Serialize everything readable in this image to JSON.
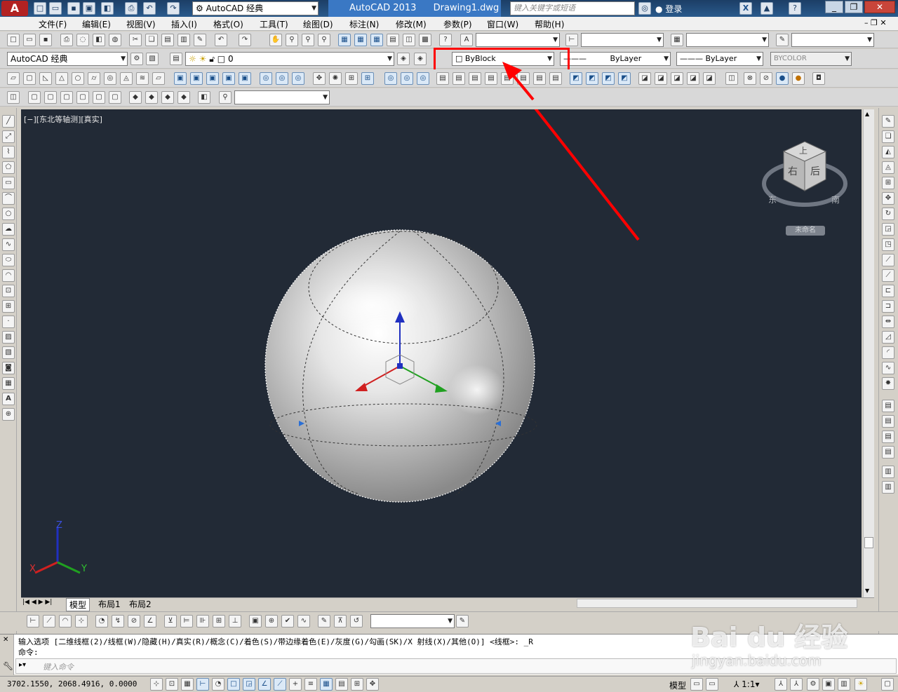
{
  "titlebar": {
    "workspace_combo": "AutoCAD 经典",
    "app_title": "AutoCAD 2013",
    "doc_title": "Drawing1.dwg",
    "search_placeholder": "键入关键字或短语",
    "login_label": "登录",
    "help_label": "?"
  },
  "menu": [
    "文件(F)",
    "编辑(E)",
    "视图(V)",
    "插入(I)",
    "格式(O)",
    "工具(T)",
    "绘图(D)",
    "标注(N)",
    "修改(M)",
    "参数(P)",
    "窗口(W)",
    "帮助(H)"
  ],
  "properties": {
    "workspace": "AutoCAD 经典",
    "layer": "0",
    "color": "ByBlock",
    "linetype": "ByLayer",
    "lineweight": "ByLayer",
    "plotstyle": "BYCOLOR"
  },
  "viewport": {
    "label": "[−][东北等轴测][真实]",
    "viewcube_top": "上",
    "viewcube_right": "右",
    "viewcube_front": "后",
    "compass_e": "东",
    "compass_s": "南",
    "named_view": "未命名",
    "ucs_z": "Z",
    "ucs_x": "X",
    "ucs_y": "Y"
  },
  "tabs": [
    "模型",
    "布局1",
    "布局2"
  ],
  "command": {
    "history": "输入选项 [二维线框(2)/线框(W)/隐藏(H)/真实(R)/概念(C)/着色(S)/带边缘着色(E)/灰度(G)/勾画(SK)/X 射线(X)/其他(O)] <线框>: _R",
    "prompt": "命令:",
    "input_placeholder": "键入命令"
  },
  "status": {
    "coordinates": "3702.1550, 2068.4916, 0.0000",
    "model_label": "模型",
    "scale": "1:1"
  },
  "watermark": {
    "brand": "Bai du 经验",
    "url": "jingyan.baidu.com"
  },
  "colors": {
    "viewport_bg": "#222a36",
    "highlight_box": "#ff0000",
    "arrow": "#ff0000",
    "gizmo_z": "#2030c0",
    "gizmo_x": "#d02020",
    "gizmo_y": "#20a020"
  }
}
